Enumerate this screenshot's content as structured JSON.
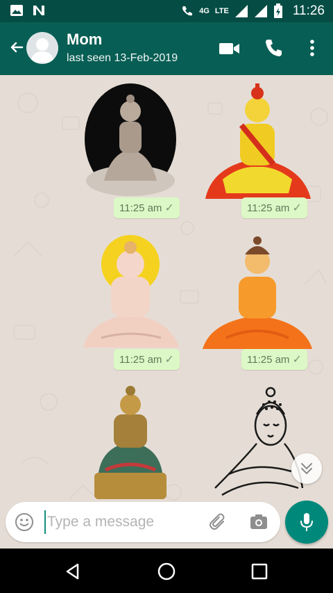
{
  "status_bar": {
    "left_icons": [
      "image-icon",
      "n-logo-icon"
    ],
    "network_type": "4G",
    "lte": "LTE",
    "time": "11:26"
  },
  "header": {
    "back_icon": "arrow-left-icon",
    "contact_name": "Mom",
    "last_seen": "last seen 13-Feb-2019",
    "actions": [
      "video-call-icon",
      "phone-icon",
      "more-vert-icon"
    ]
  },
  "messages": [
    {
      "type": "sticker",
      "subject": "buddha-statue-dark-oval",
      "time": "11:25 am"
    },
    {
      "type": "sticker",
      "subject": "buddha-red-yellow",
      "time": "11:25 am"
    },
    {
      "type": "sticker",
      "subject": "buddha-white-halo",
      "time": "11:25 am"
    },
    {
      "type": "sticker",
      "subject": "buddha-orange",
      "time": "11:25 am"
    },
    {
      "type": "sticker",
      "subject": "buddha-golden-statue",
      "time": ""
    },
    {
      "type": "sticker",
      "subject": "buddha-line-sketch",
      "time": ""
    }
  ],
  "composer": {
    "placeholder": "Type a message",
    "value": ""
  },
  "colors": {
    "status_bar": "#054d44",
    "app_bar": "#075e54",
    "chat_bg": "#e5ddd5",
    "outgoing_bubble": "#dcf8c6",
    "fab": "#00897b"
  }
}
